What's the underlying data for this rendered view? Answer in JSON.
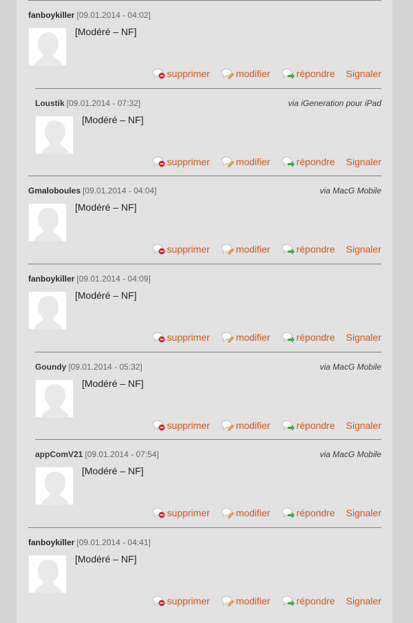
{
  "actions": {
    "delete": "supprimer",
    "edit": "modifier",
    "reply": "répondre",
    "report": "Signaler"
  },
  "icons": {
    "delete": "speech-bubble-minus-icon",
    "edit": "speech-bubble-pencil-icon",
    "reply": "speech-bubble-arrow-icon"
  },
  "colors": {
    "action": "#d1541e",
    "delete_badge": "#d0242c",
    "reply_arrow": "#3aa63a",
    "edit_pencil": "#e0a935"
  },
  "comments": [
    {
      "author": "fanboykiller",
      "date": "[09.01.2014 - 04:02]",
      "via": "",
      "text": "[Modéré – NF]",
      "reply": false
    },
    {
      "author": "Loustik",
      "date": "[09.01.2014 - 07:32]",
      "via": "via iGeneration pour iPad",
      "text": "[Modéré – NF]",
      "reply": true
    },
    {
      "author": "Gmaloboules",
      "date": "[09.01.2014 - 04:04]",
      "via": "via MacG Mobile",
      "text": "[Modéré – NF]",
      "reply": false
    },
    {
      "author": "fanboykiller",
      "date": "[09.01.2014 - 04:09]",
      "via": "",
      "text": "[Modéré – NF]",
      "reply": false
    },
    {
      "author": "Goundy",
      "date": "[09.01.2014 - 05:32]",
      "via": "via MacG Mobile",
      "text": "[Modéré – NF]",
      "reply": true
    },
    {
      "author": "appComV21",
      "date": "[09.01.2014 - 07:54]",
      "via": "via MacG Mobile",
      "text": "[Modéré – NF]",
      "reply": true
    },
    {
      "author": "fanboykiller",
      "date": "[09.01.2014 - 04:41]",
      "via": "",
      "text": "[Modéré – NF]",
      "reply": false
    }
  ]
}
